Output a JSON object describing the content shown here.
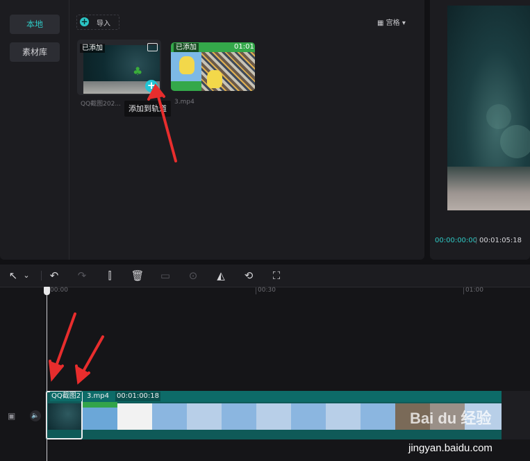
{
  "sidebar": {
    "items": [
      {
        "label": "本地",
        "active": true
      },
      {
        "label": "素材库",
        "active": false
      }
    ]
  },
  "media": {
    "import_label": "导入",
    "view_mode_label": "宫格",
    "cards": [
      {
        "added_label": "已添加",
        "name": "QQ截图202...",
        "type": "image"
      },
      {
        "added_label": "已添加",
        "name": "3.mp4",
        "duration": "01:01",
        "type": "video"
      }
    ],
    "tooltip": "添加到轨道"
  },
  "preview": {
    "current_time": "00:00:00:00",
    "separator": "|",
    "total_time": "00:01:05:18"
  },
  "toolbar": {
    "icons": [
      "select-pointer",
      "undo",
      "redo",
      "split",
      "delete",
      "freeze",
      "play-reverse",
      "mirror",
      "rotate",
      "crop"
    ]
  },
  "timeline": {
    "ruler": [
      "00:00",
      "00:30",
      "01:00"
    ],
    "clips": [
      {
        "label": "QQ截图2"
      },
      {
        "label": "3.mp4"
      },
      {
        "label": "00:01:00:18"
      }
    ]
  },
  "watermark": {
    "text": "Bai du 经验",
    "url": "jingyan.baidu.com"
  },
  "colors": {
    "accent": "#2fc9c5",
    "annotation": "#e82d2d",
    "clip_track": "#0f5a58"
  }
}
